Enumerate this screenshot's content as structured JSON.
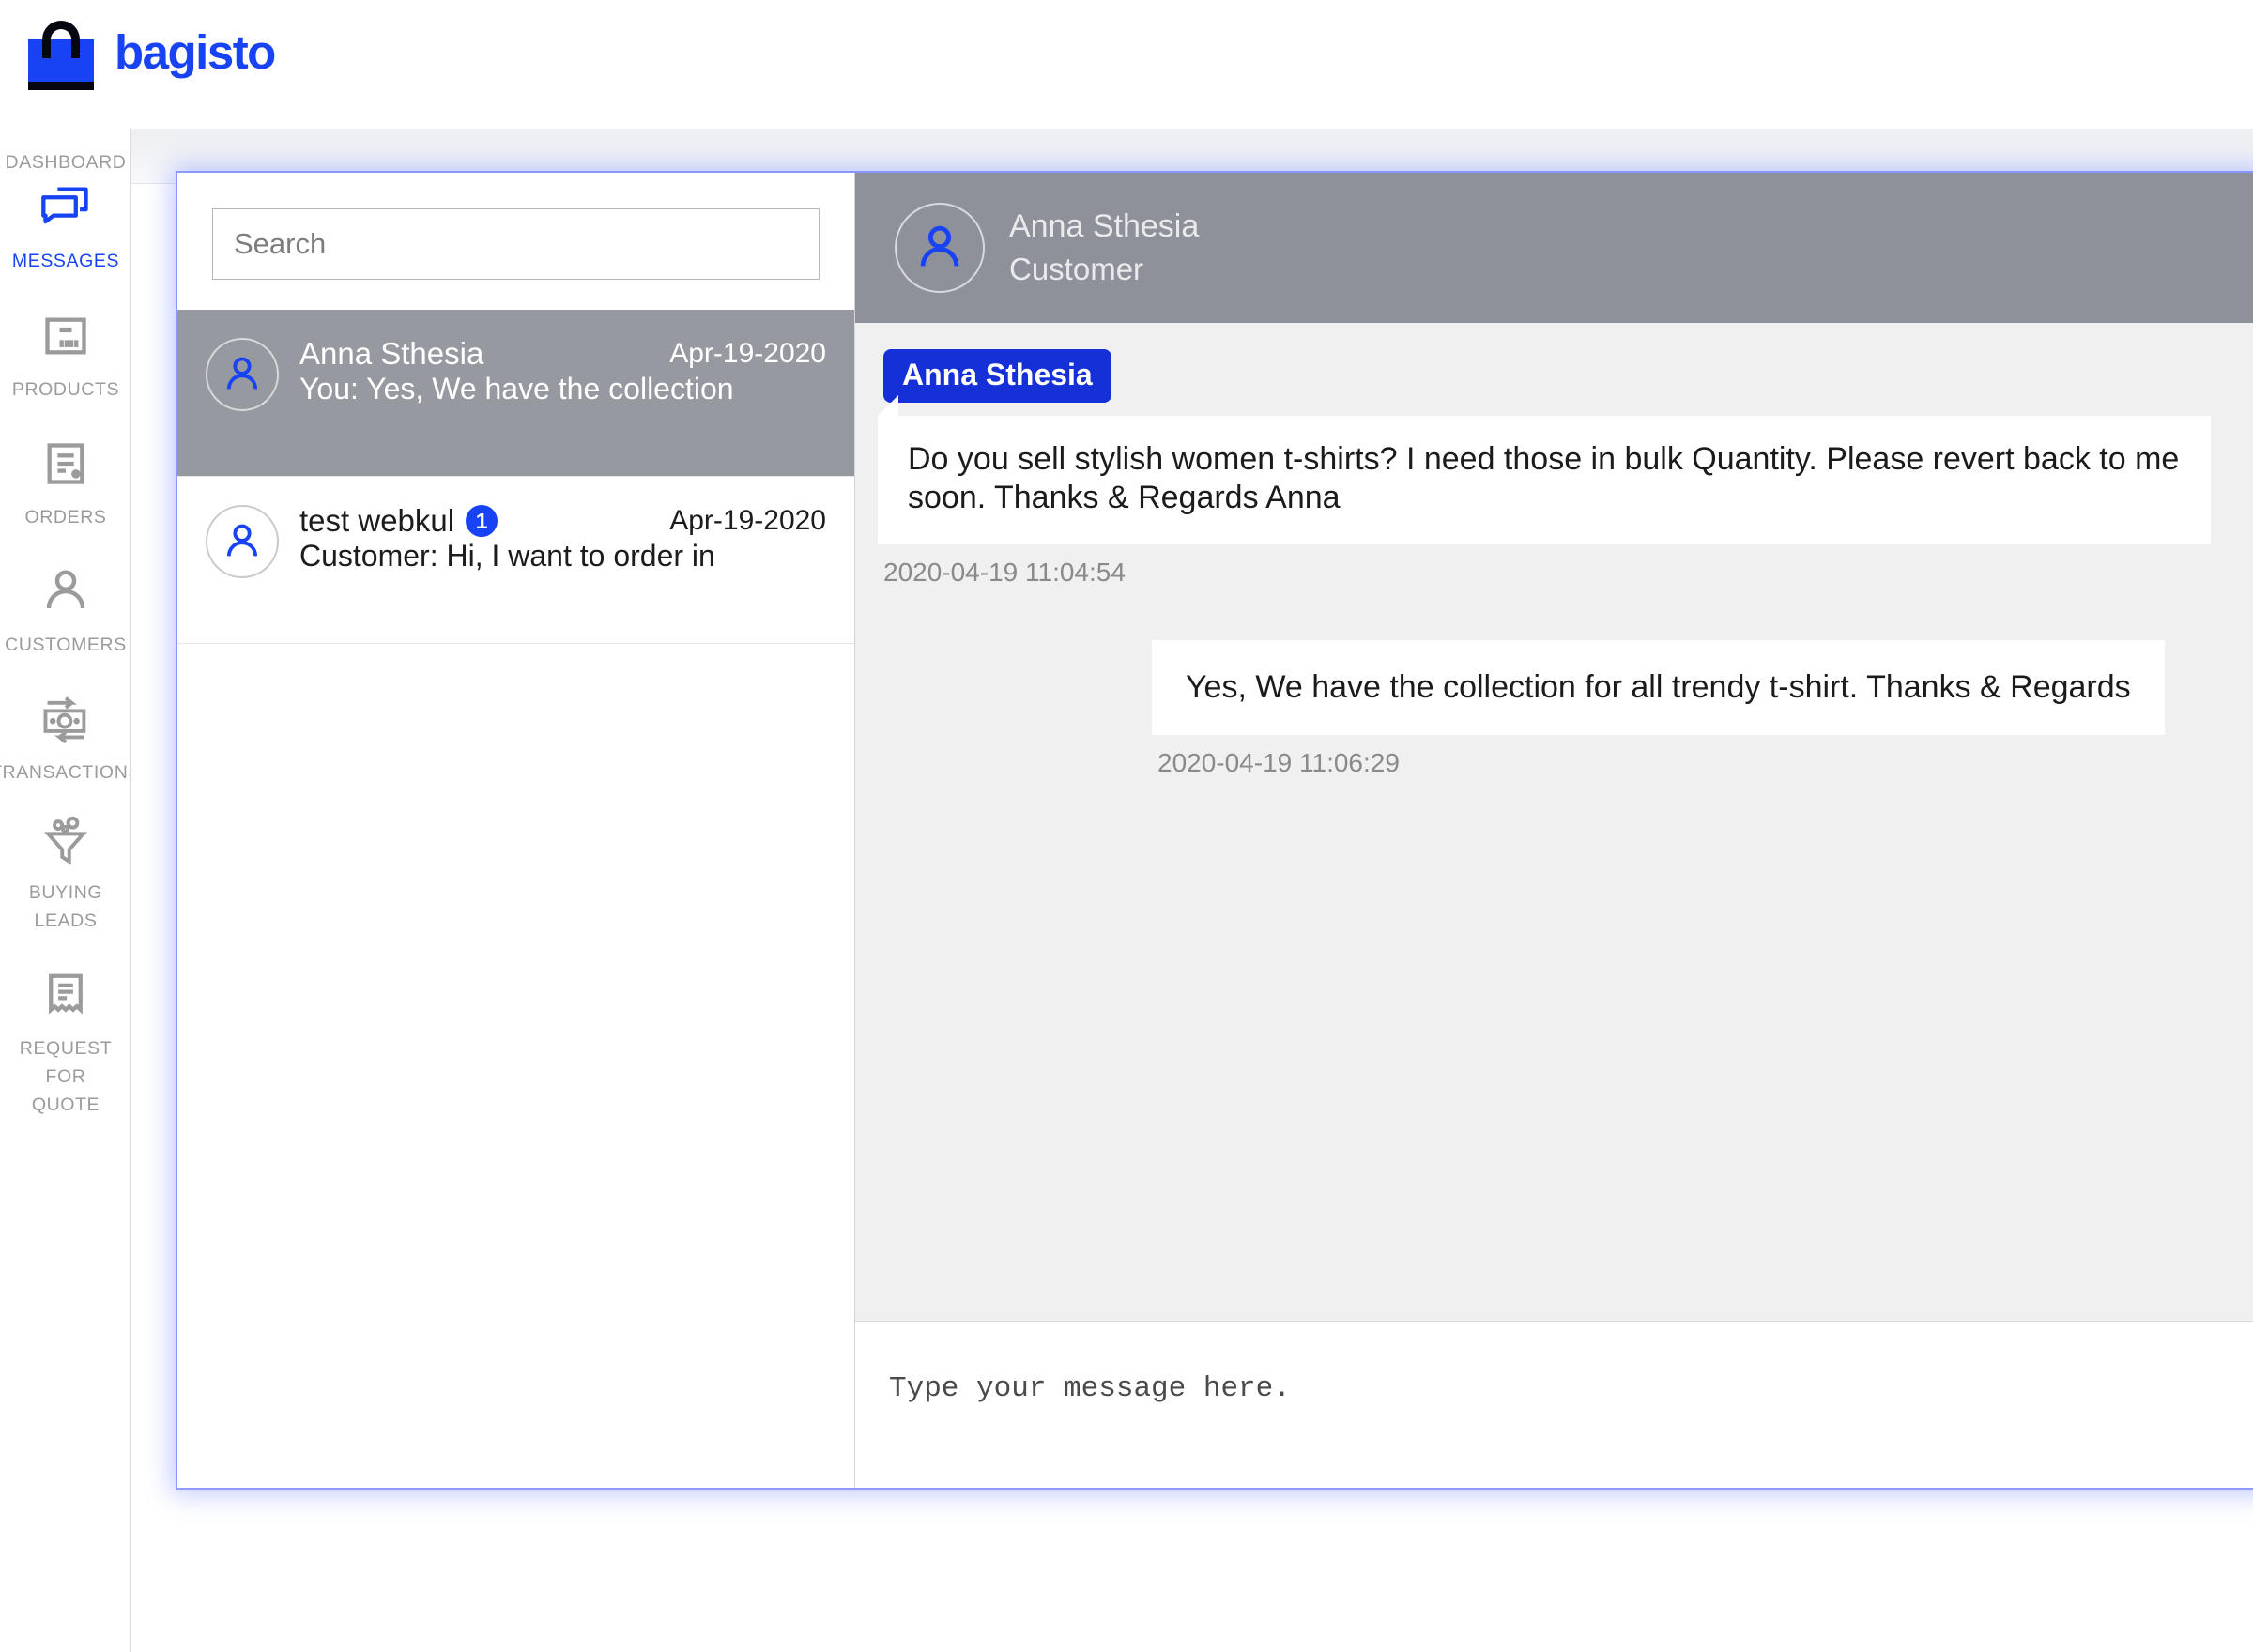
{
  "brand": {
    "name": "bagisto",
    "logo_color": "#1843f5",
    "accent": "#1843f5"
  },
  "sidebar": {
    "items": [
      {
        "label": "DASHBOARD",
        "icon": "dashboard-icon",
        "active": false
      },
      {
        "label": "MESSAGES",
        "icon": "messages-icon",
        "active": true
      },
      {
        "label": "PRODUCTS",
        "icon": "products-icon",
        "active": false
      },
      {
        "label": "ORDERS",
        "icon": "orders-icon",
        "active": false
      },
      {
        "label": "CUSTOMERS",
        "icon": "customers-icon",
        "active": false
      },
      {
        "label": "TRANSACTIONS",
        "icon": "transactions-icon",
        "active": false
      },
      {
        "label": "BUYING\nLEADS",
        "icon": "buying-leads-icon",
        "active": false
      },
      {
        "label": "REQUEST FOR\nQUOTE",
        "icon": "request-for-quote-icon",
        "active": false
      }
    ]
  },
  "search": {
    "value": "",
    "placeholder": "Search"
  },
  "conversations": [
    {
      "name": "Anna Sthesia",
      "date": "Apr-19-2020",
      "snippet": "You: Yes, We have the collection",
      "unread": "",
      "selected": true
    },
    {
      "name": "test webkul",
      "date": "Apr-19-2020",
      "snippet": "Customer: Hi, I want to order in",
      "unread": "1",
      "selected": false
    }
  ],
  "chat": {
    "header": {
      "name": "Anna Sthesia",
      "role": "Customer"
    },
    "messages": [
      {
        "direction": "in",
        "sender_tag": "Anna Sthesia",
        "text": "Do you sell stylish women t-shirts? I need those in bulk Quantity. Please revert back to me soon. Thanks & Regards Anna",
        "time": "2020-04-19 11:04:54"
      },
      {
        "direction": "out",
        "sender_tag": "",
        "text": "Yes, We have the collection for all trendy t-shirt. Thanks & Regards",
        "time": "2020-04-19 11:06:29"
      }
    ],
    "composer": {
      "value": "",
      "placeholder": "Type your message here."
    }
  }
}
